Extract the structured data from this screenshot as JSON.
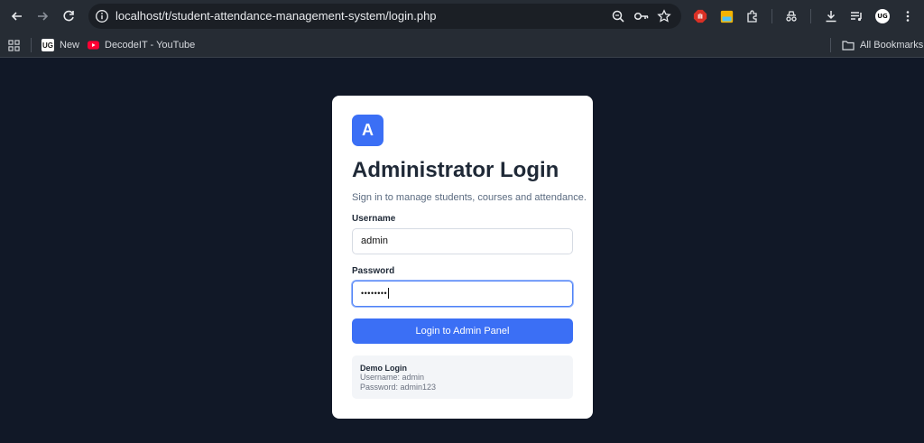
{
  "browser": {
    "url": "localhost/t/student-attendance-management-system/login.php",
    "bookmarks": [
      {
        "label": "New",
        "icon": "ug-logo-icon"
      },
      {
        "label": "DecodeIT - YouTube",
        "icon": "youtube-icon"
      }
    ],
    "all_bookmarks_label": "All Bookmarks",
    "avatar_text": "UG"
  },
  "login": {
    "logo_letter": "A",
    "title": "Administrator Login",
    "subtitle": "Sign in to manage students, courses and attendance.",
    "username_label": "Username",
    "username_value": "admin",
    "password_label": "Password",
    "password_value": "••••••••",
    "submit_label": "Login to Admin Panel",
    "demo_title": "Demo Login",
    "demo_username": "Username: admin",
    "demo_password": "Password: admin123"
  },
  "colors": {
    "page_bg": "#111827",
    "accent": "#3b6ff5",
    "chrome_bg": "#262c34"
  }
}
